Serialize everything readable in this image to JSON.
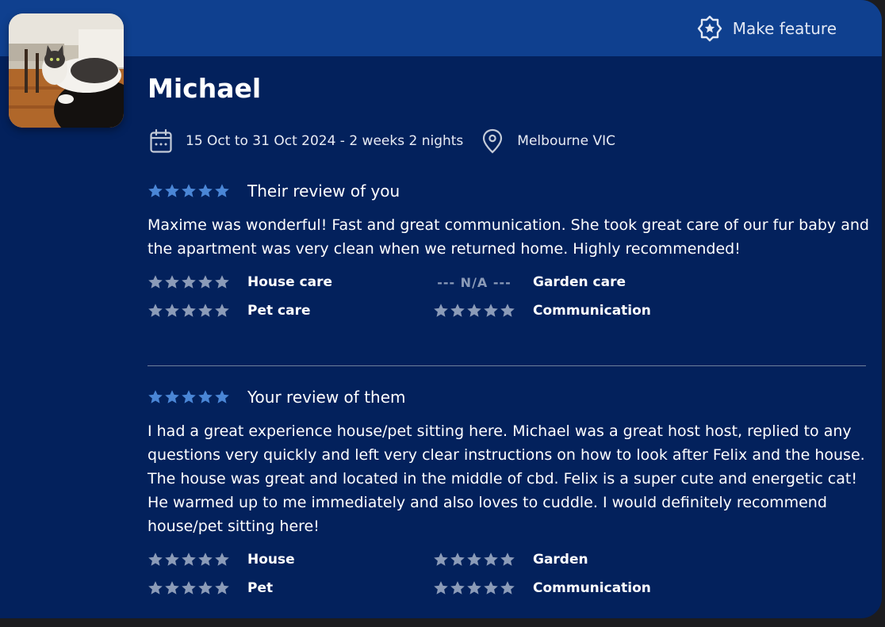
{
  "header": {
    "feature_label": "Make feature",
    "feature_icon": "star-badge-icon"
  },
  "profile": {
    "name": "Michael",
    "photo_alt": "cat-photo"
  },
  "trip": {
    "dates": "15 Oct to 31 Oct 2024 - 2 weeks 2 nights",
    "location": "Melbourne VIC",
    "date_icon": "calendar-icon",
    "location_icon": "location-pin-icon"
  },
  "their_review": {
    "rating": 5,
    "title": "Their review of you",
    "text": "Maxime was wonderful! Fast and great communication. She took great care of our fur baby and the apartment was very clean when we returned home. Highly recommended!",
    "categories": [
      {
        "label": "House care",
        "rating": 5,
        "value_text": ""
      },
      {
        "label": "Garden care",
        "rating": null,
        "value_text": "--- N/A ---"
      },
      {
        "label": "Pet care",
        "rating": 5,
        "value_text": ""
      },
      {
        "label": "Communication",
        "rating": 5,
        "value_text": ""
      }
    ]
  },
  "your_review": {
    "rating": 5,
    "title": "Your review of them",
    "text": "I had a great experience house/pet sitting here. Michael was a great host host, replied to any questions very quickly and left very clear instructions on how to look after Felix and the house. The house was great and located in the middle of cbd. Felix is a super cute and energetic cat! He warmed up to me immediately and also loves to cuddle. I would definitely recommend house/pet sitting here!",
    "categories": [
      {
        "label": "House",
        "rating": 5
      },
      {
        "label": "Garden",
        "rating": 5
      },
      {
        "label": "Pet",
        "rating": 5
      },
      {
        "label": "Communication",
        "rating": 5
      }
    ]
  },
  "colors": {
    "card_bg": "#03215c",
    "topbar_bg": "#0f408f",
    "main_star": "#4a86d6",
    "sub_star": "#8b9bb8"
  }
}
